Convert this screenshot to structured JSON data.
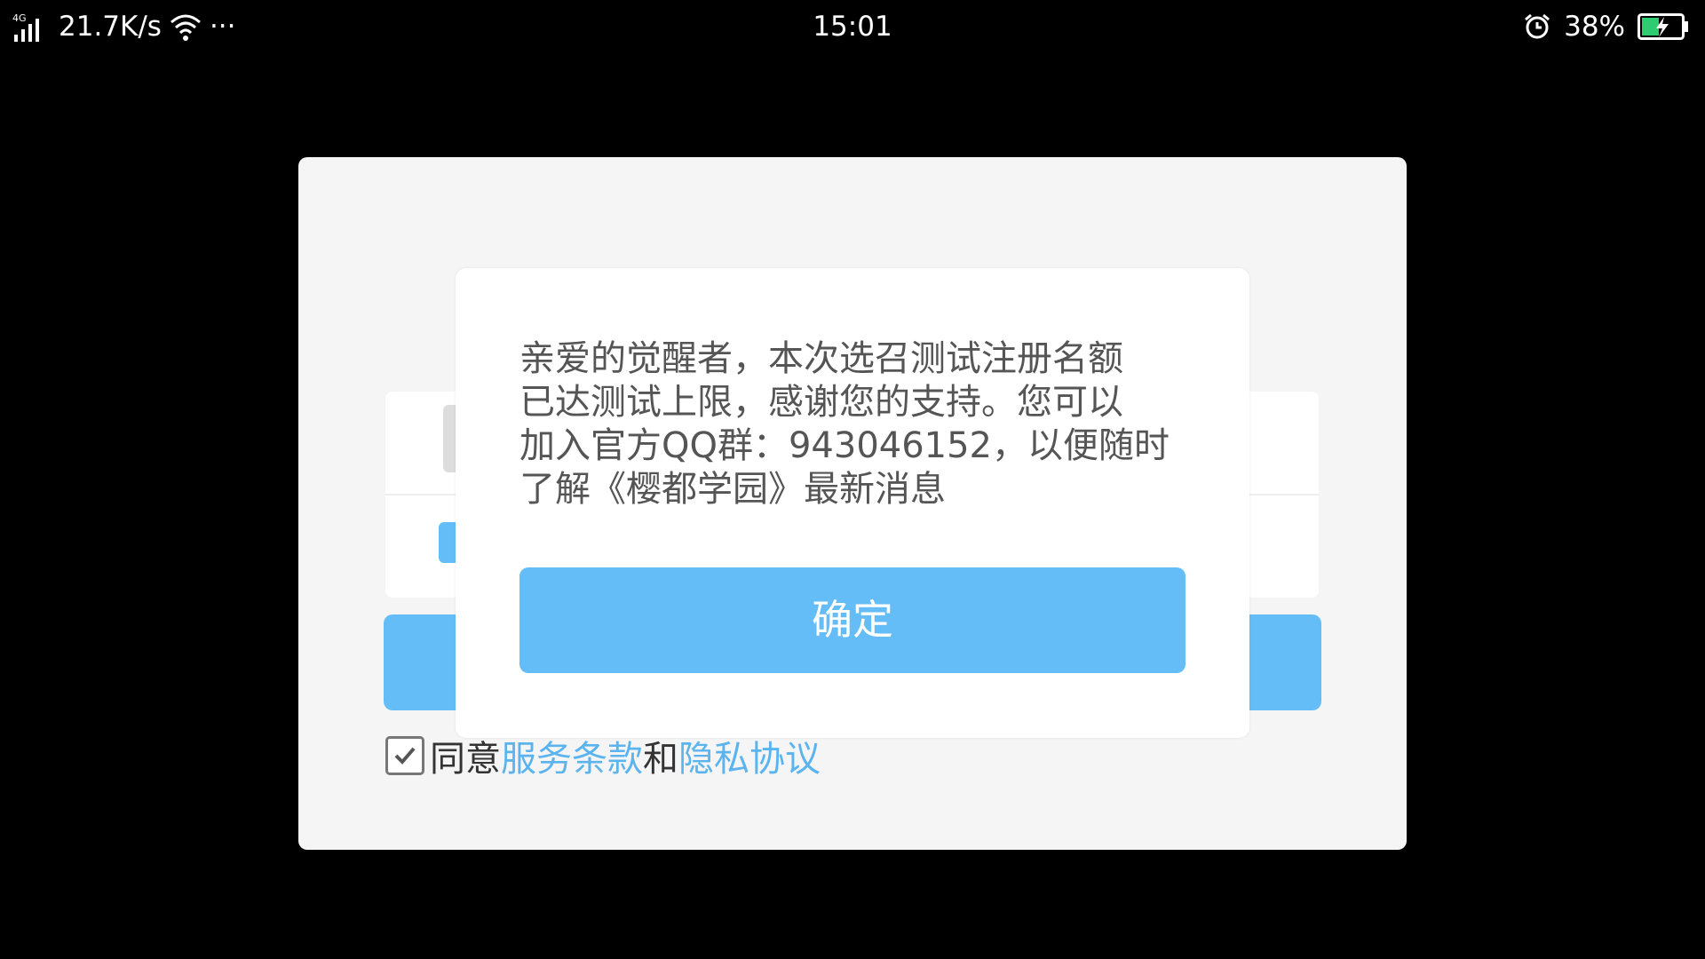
{
  "status_bar": {
    "network_type": "4G",
    "net_speed": "21.7K/s",
    "more": "···",
    "time": "15:01",
    "battery": "38%",
    "icons": {
      "signal": "signal-icon",
      "wifi": "wifi-icon",
      "alarm": "alarm-icon",
      "battery": "battery-charging-icon"
    },
    "battery_color": "#2ecc71"
  },
  "login_card": {
    "agreement": {
      "prefix": "同意",
      "terms_link": "服务条款",
      "conjunction": "和",
      "privacy_link": "隐私协议"
    }
  },
  "dialog": {
    "message_lines": [
      "亲爱的觉醒者，本次选召测试注册名额",
      "已达测试上限，感谢您的支持。您可以",
      "加入官方QQ群：943046152，以便随时",
      "了解《樱都学园》最新消息"
    ],
    "confirm_label": "确定"
  },
  "colors": {
    "accent": "#65bdf8",
    "link": "#5cb4ee",
    "background": "#000000",
    "card": "#f5f5f5"
  }
}
